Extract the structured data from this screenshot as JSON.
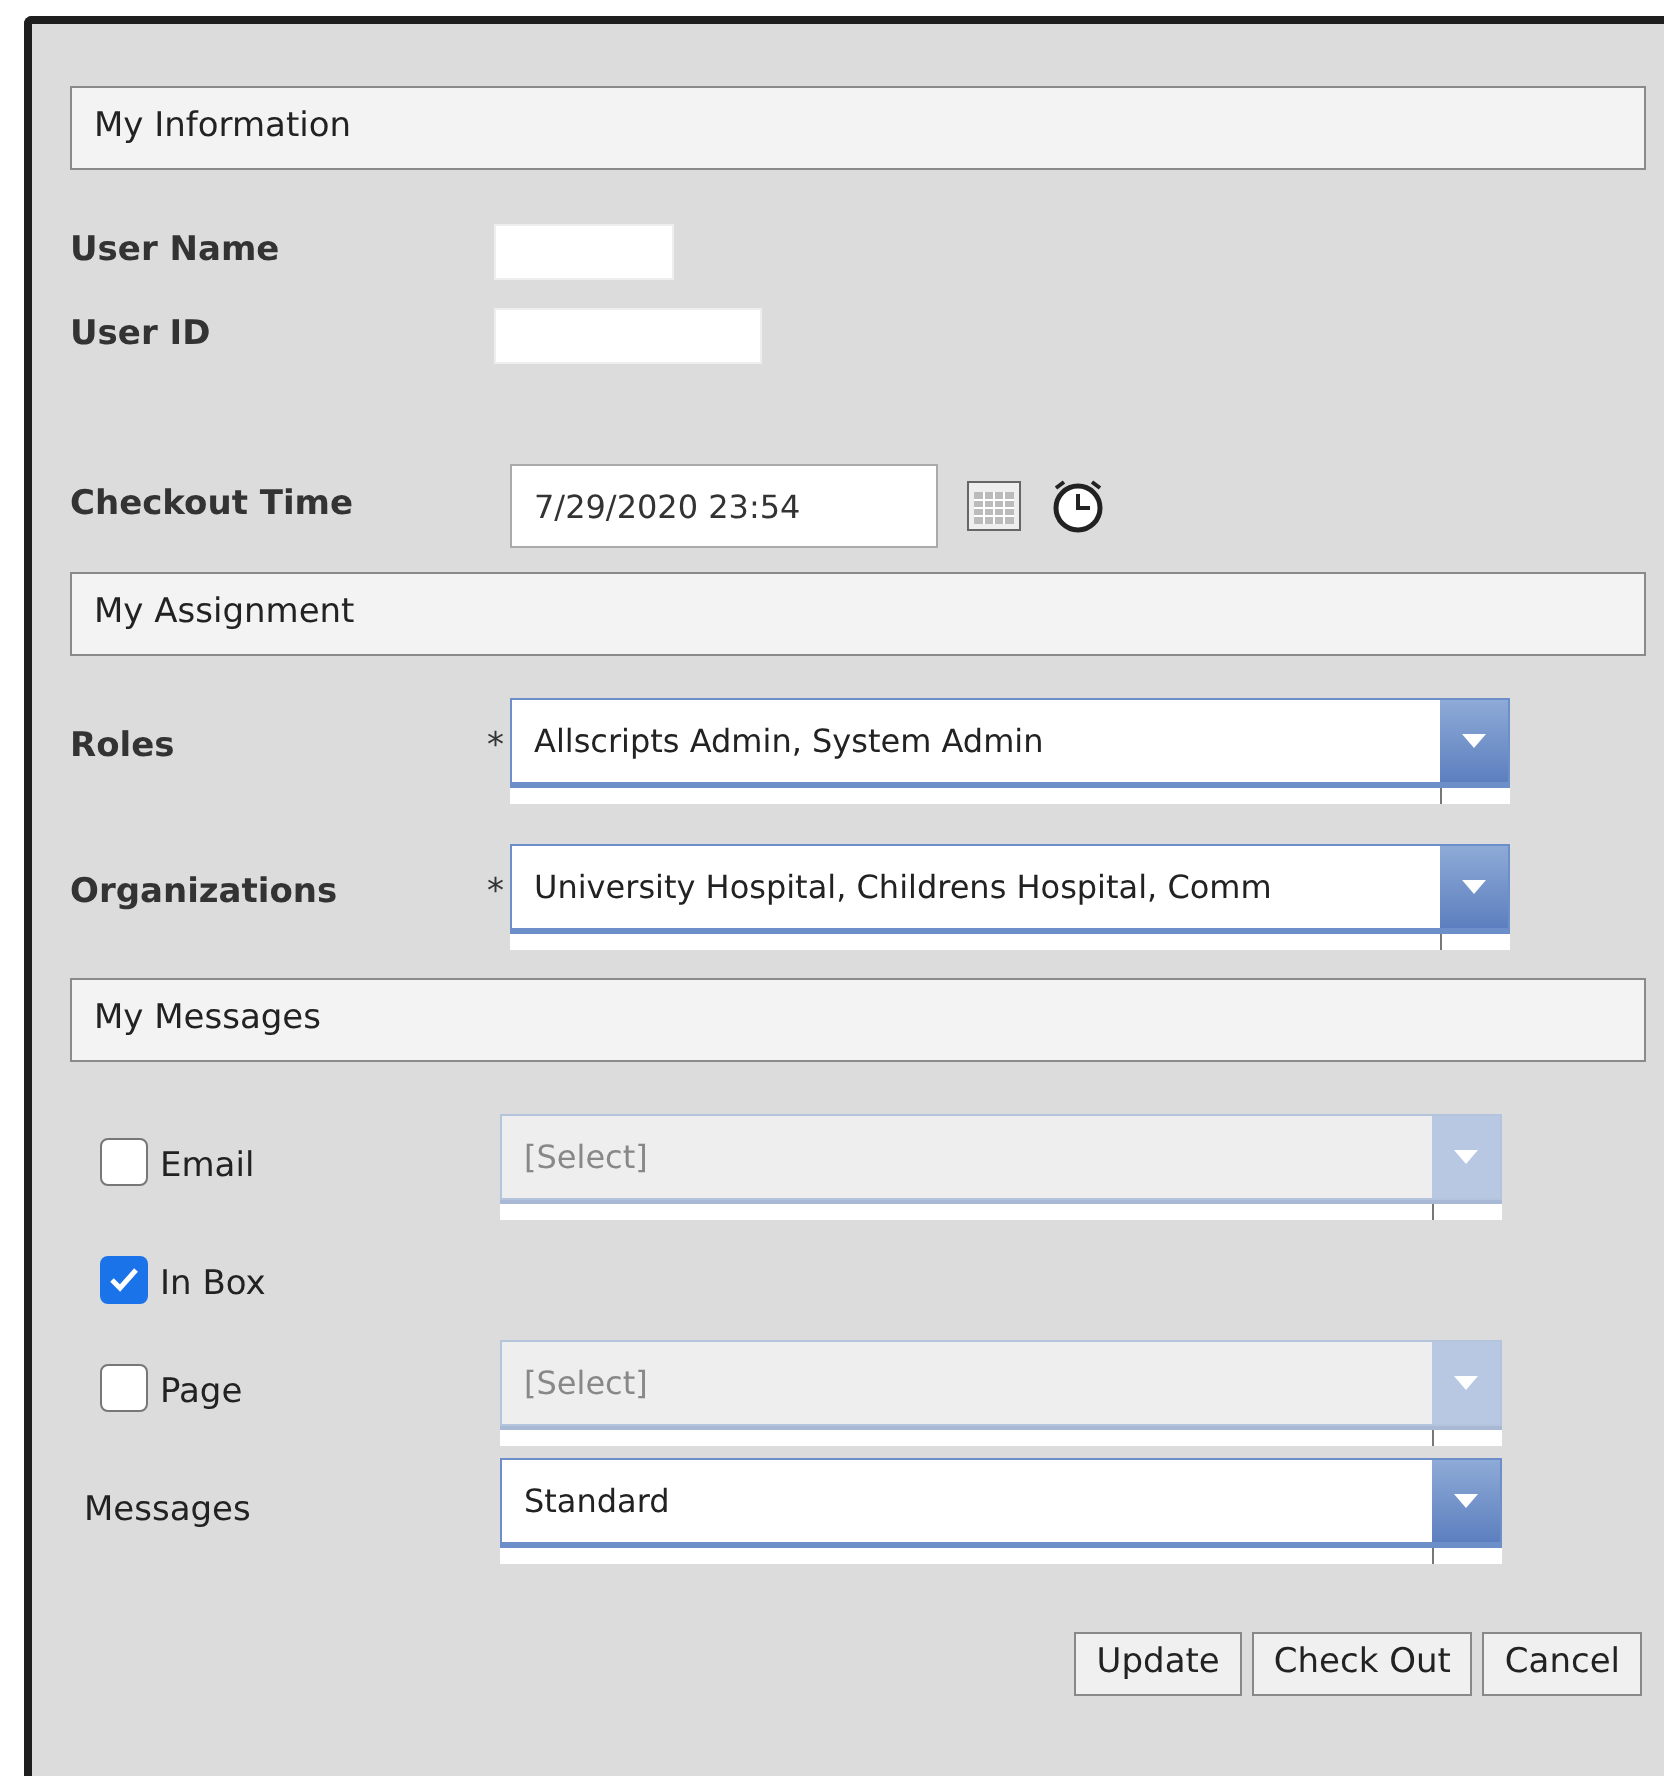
{
  "sections": [
    {
      "kind": "info",
      "title": "My Information",
      "fields": [
        {
          "label": "User Name"
        },
        {
          "label": "User ID"
        }
      ],
      "checkout": {
        "label": "Checkout Time",
        "value": "7/29/2020 23:54"
      }
    },
    {
      "kind": "assignment",
      "title": "My Assignment",
      "rows": [
        {
          "label": "Roles",
          "required_mark": "*",
          "value": "Allscripts Admin, System Admin"
        },
        {
          "label": "Organizations",
          "required_mark": "*",
          "value": "University Hospital, Childrens Hospital, Comm"
        }
      ]
    },
    {
      "kind": "messages",
      "title": "My Messages",
      "rows": [
        {
          "kind": "checkbox",
          "label": "Email",
          "checked": false,
          "select": {
            "value": "[Select]",
            "disabled": true
          }
        },
        {
          "kind": "checkbox",
          "label": "In Box",
          "checked": true
        },
        {
          "kind": "checkbox",
          "label": "Page",
          "checked": false,
          "select": {
            "value": "[Select]",
            "disabled": true
          }
        },
        {
          "kind": "label",
          "label": "Messages",
          "select": {
            "value": "Standard",
            "disabled": false
          }
        }
      ]
    }
  ],
  "buttons": [
    "Update",
    "Check Out",
    "Cancel"
  ]
}
